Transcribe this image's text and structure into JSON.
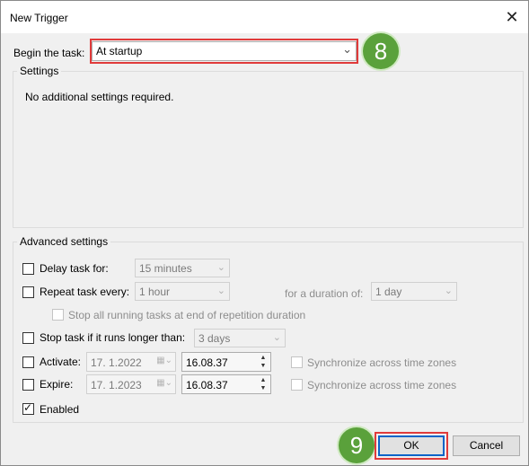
{
  "window": {
    "title": "New Trigger",
    "close_glyph": "✕"
  },
  "begin": {
    "label": "Begin the task:",
    "value": "At startup",
    "arrow": "⌄"
  },
  "settings": {
    "title": "Settings",
    "message": "No additional settings required."
  },
  "advanced": {
    "title": "Advanced settings",
    "delay": {
      "label": "Delay task for:",
      "value": "15 minutes",
      "checked": false
    },
    "repeat": {
      "label": "Repeat task every:",
      "value": "1 hour",
      "checked": false,
      "duration_label": "for a duration of:",
      "duration_value": "1 day"
    },
    "stop_all": {
      "label": "Stop all running tasks at end of repetition duration"
    },
    "stop_longer": {
      "label": "Stop task if it runs longer than:",
      "value": "3 days",
      "checked": false
    },
    "activate": {
      "label": "Activate:",
      "date": "17.  1.2022",
      "time": "16.08.37",
      "sync_label": "Synchronize across time zones",
      "checked": false
    },
    "expire": {
      "label": "Expire:",
      "date": "17.  1.2023",
      "time": "16.08.37",
      "sync_label": "Synchronize across time zones",
      "checked": false
    },
    "enabled": {
      "label": "Enabled",
      "checked": true
    }
  },
  "buttons": {
    "ok": "OK",
    "cancel": "Cancel"
  },
  "badges": {
    "first": "8",
    "second": "9"
  },
  "colors": {
    "highlight": "#e03b3b",
    "badge": "#5aa13b"
  }
}
